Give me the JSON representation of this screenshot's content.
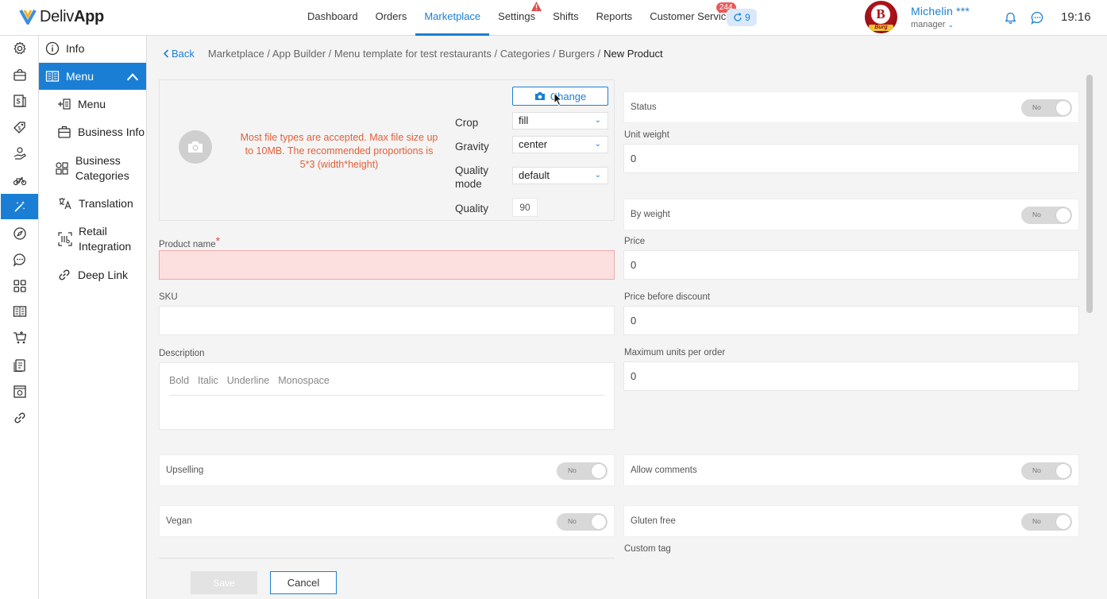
{
  "app": {
    "logo_light": "Deliv",
    "logo_bold": "App"
  },
  "nav": {
    "items": [
      "Dashboard",
      "Orders",
      "Marketplace",
      "Settings",
      "Shifts",
      "Reports",
      "Customer Service"
    ],
    "active": "Marketplace",
    "customer_service_badge": "244",
    "pill_count": "9"
  },
  "user": {
    "name": "Michelin ***",
    "role": "manager",
    "avatar_letter": "B",
    "avatar_word": "Burg"
  },
  "clock": "19:16",
  "rail": {
    "icons": [
      "gear-icon",
      "basket-icon",
      "money-icon",
      "tags-icon",
      "hand-coin-icon",
      "scooter-icon",
      "magic-wand-icon",
      "compass-icon",
      "chat-icon",
      "apps-grid-icon",
      "book-icon",
      "cart-icon",
      "document-icon",
      "receipt-icon",
      "link-icon"
    ],
    "active": "magic-wand-icon"
  },
  "subnav": {
    "info": "Info",
    "menu": "Menu",
    "items": [
      "Menu",
      "Business Info",
      "Business Categories",
      "Translation",
      "Retail Integration",
      "Deep Link"
    ]
  },
  "breadcrumb": {
    "back": "Back",
    "path": "Marketplace / App Builder / Menu template for test restaurants / Categories / Burgers /",
    "current": "New Product"
  },
  "image": {
    "hint": "Most file types are accepted. Max file size up to 10MB. The recommended proportions is 5*3 (width*height)",
    "change_label": "Change",
    "crop_label": "Crop",
    "crop_value": "fill",
    "gravity_label": "Gravity",
    "gravity_value": "center",
    "quality_mode_label": "Quality mode",
    "quality_mode_value": "default",
    "quality_label": "Quality",
    "quality_value": "90"
  },
  "form": {
    "product_name_label": "Product name",
    "required_mark": "*",
    "sku_label": "SKU",
    "description_label": "Description",
    "desc_tools": [
      "Bold",
      "Italic",
      "Underline",
      "Monospace"
    ],
    "status_label": "Status",
    "unit_weight_label": "Unit weight",
    "unit_weight_value": "0",
    "by_weight_label": "By weight",
    "price_label": "Price",
    "price_value": "0",
    "price_before_discount_label": "Price before discount",
    "price_before_discount_value": "0",
    "max_units_label": "Maximum units per order",
    "max_units_value": "0",
    "upselling_label": "Upselling",
    "allow_comments_label": "Allow comments",
    "vegan_label": "Vegan",
    "gluten_free_label": "Gluten free",
    "custom_tag_label": "Custom tag",
    "toggle_off": "No"
  },
  "actions": {
    "save": "Save",
    "cancel": "Cancel"
  },
  "colors": {
    "accent": "#1a7fd4",
    "error_fill": "#fce0e0",
    "hint": "#e2603a"
  }
}
